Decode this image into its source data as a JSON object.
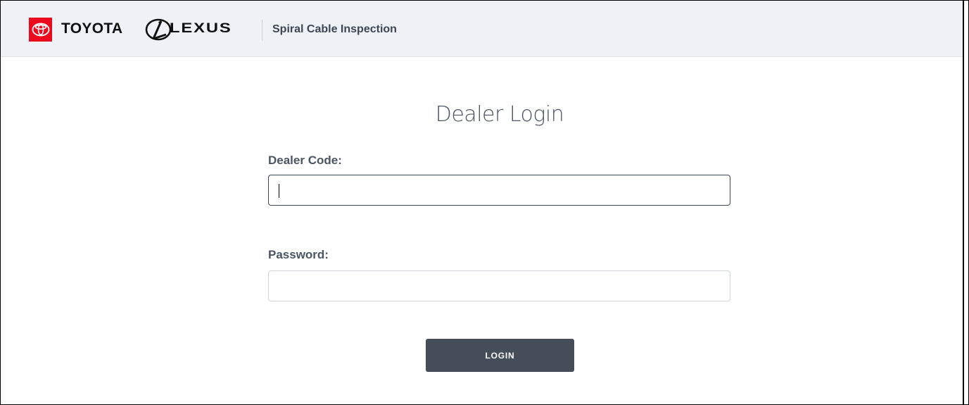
{
  "header": {
    "brand_toyota": "TOYOTA",
    "brand_lexus": "LEXUS",
    "app_title": "Spiral Cable Inspection"
  },
  "form": {
    "title": "Dealer Login",
    "dealer_code_label": "Dealer Code:",
    "dealer_code_value": "",
    "password_label": "Password:",
    "password_value": "",
    "login_button": "LOGIN"
  },
  "colors": {
    "toyota_red": "#eb0a1e",
    "header_bg": "#eef2f6",
    "button_bg": "#454d59",
    "label_text": "#4b5563"
  },
  "icons": {
    "toyota_logo": "toyota-emblem-icon",
    "lexus_logo": "lexus-emblem-icon"
  }
}
